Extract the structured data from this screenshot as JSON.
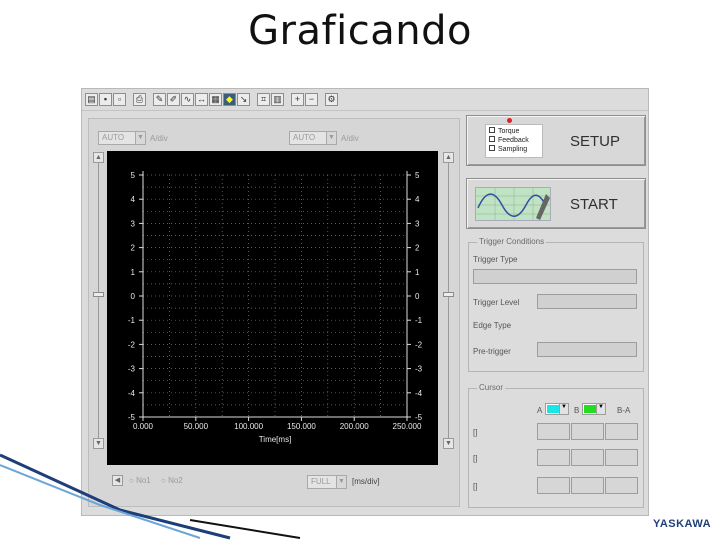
{
  "slide": {
    "title": "Graficando",
    "brand": "YASKAWA"
  },
  "toolbar": {
    "icons": [
      "open-icon",
      "save-icon",
      "save-as-icon",
      "print-icon",
      "draw-icon",
      "edit-icon",
      "waveform-icon",
      "measure-icon",
      "table-icon",
      "color-icon",
      "trend-icon",
      "fft-icon",
      "zoom-in-icon",
      "zoom-out-icon",
      "settings-icon"
    ]
  },
  "plot": {
    "left_scale": {
      "value": "AUTO",
      "unit": "A/div"
    },
    "right_scale": {
      "value": "AUTO",
      "unit": "A/div"
    },
    "time_scale": {
      "value": "FULL",
      "unit": "[ms/div]"
    },
    "cursor_radio_1": "No1",
    "cursor_radio_2": "No2"
  },
  "chart_data": {
    "type": "line",
    "xlabel": "Time[ms]",
    "ylabel": "",
    "xlim": [
      0,
      250
    ],
    "ylim": [
      -5,
      5
    ],
    "x_ticks": [
      "0.000",
      "50.000",
      "100.000",
      "150.000",
      "200.000",
      "250.000"
    ],
    "x_tick_values": [
      0,
      50,
      100,
      150,
      200,
      250
    ],
    "y_ticks_left": [
      "5",
      "4",
      "3",
      "2",
      "1",
      "0",
      "-1",
      "-2",
      "-3",
      "-4",
      "-5"
    ],
    "y_ticks_right": [
      "5",
      "4",
      "3",
      "2",
      "1",
      "0",
      "-1",
      "-2",
      "-3",
      "-4",
      "-5"
    ],
    "y_tick_values": [
      5,
      4,
      3,
      2,
      1,
      0,
      -1,
      -2,
      -3,
      -4,
      -5
    ],
    "x_minor_step": 25,
    "y_minor_step": 0.5,
    "grid": true,
    "series": []
  },
  "setup": {
    "label": "SETUP",
    "checks": [
      "Torque",
      "Feedback",
      "Sampling"
    ]
  },
  "start": {
    "label": "START"
  },
  "trigger": {
    "title": "Trigger Conditions",
    "type_label": "Trigger Type",
    "level_label": "Trigger Level",
    "edge_label": "Edge Type",
    "pretrigger_label": "Pre-trigger"
  },
  "cursor": {
    "title": "Cursor",
    "a_label": "A",
    "b_label": "B",
    "ba_label": "B-A",
    "a_color": "#19e6e6",
    "b_color": "#22dd22",
    "row_labels": [
      "[]",
      "[]",
      "[]"
    ]
  }
}
